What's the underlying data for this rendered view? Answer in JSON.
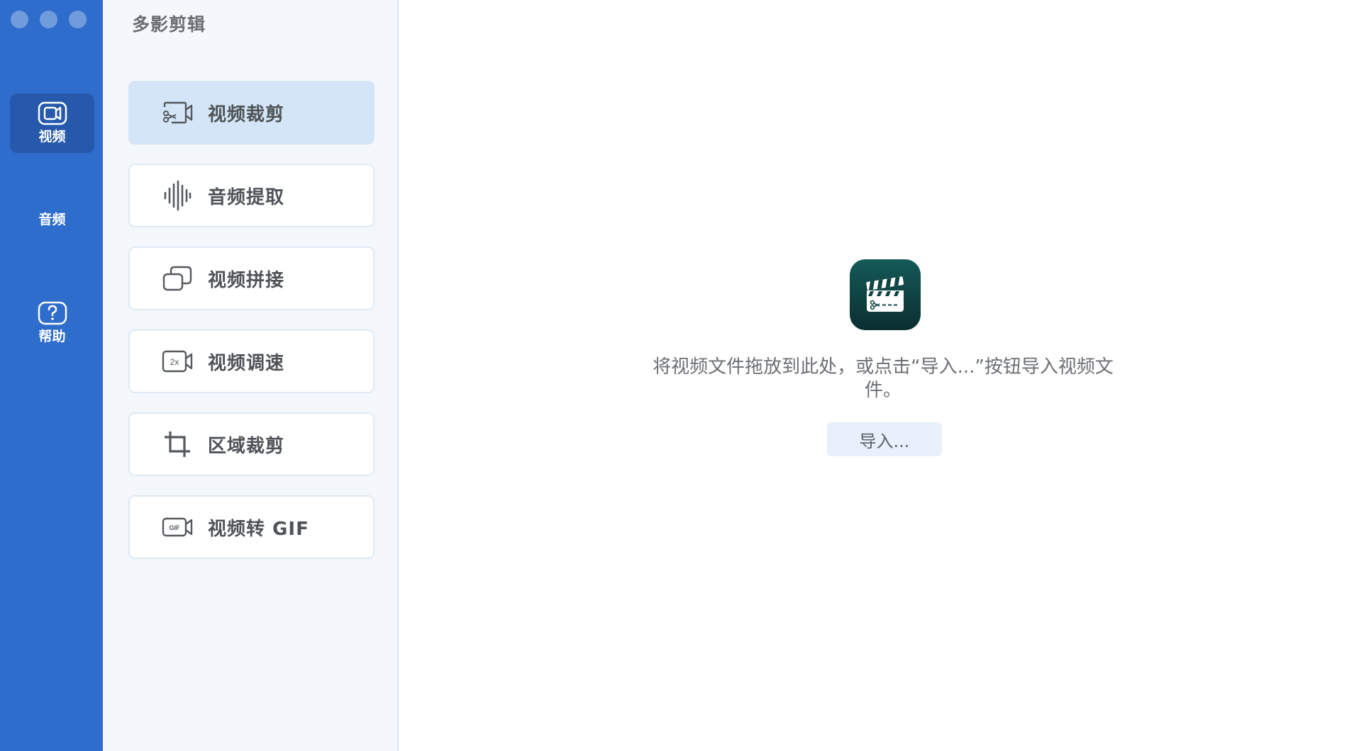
{
  "window": {
    "traffic_lights": [
      "close",
      "minimize",
      "zoom"
    ]
  },
  "rail": {
    "items": [
      {
        "label": "视频",
        "icon": "video-camera-icon",
        "active": true
      },
      {
        "label": "音频",
        "icon": "",
        "active": false
      },
      {
        "label": "帮助",
        "icon": "question-icon",
        "active": false
      }
    ]
  },
  "panel": {
    "title": "多影剪辑",
    "items": [
      {
        "label": "视频裁剪",
        "icon": "video-trim-icon",
        "active": true
      },
      {
        "label": "音频提取",
        "icon": "audio-waveform-icon",
        "active": false
      },
      {
        "label": "视频拼接",
        "icon": "video-merge-icon",
        "active": false
      },
      {
        "label": "视频调速",
        "icon": "video-speed-icon",
        "icon_text": "2x",
        "active": false
      },
      {
        "label": "区域裁剪",
        "icon": "crop-icon",
        "active": false
      },
      {
        "label": "视频转 GIF",
        "icon": "video-gif-icon",
        "icon_text": "GIF",
        "active": false
      }
    ]
  },
  "main": {
    "logo_icon": "clapperboard-icon",
    "hint": "将视频文件拖放到此处，或点击“导入...”按钮导入视频文件。",
    "import_label": "导入..."
  },
  "colors": {
    "rail_bg": "#2f6dcc",
    "rail_active": "#2659ac",
    "panel_bg": "#f4f8fd",
    "item_active": "#d3e5f6",
    "logo_top": "#145a58",
    "logo_bottom": "#0b2e2f",
    "import_bg": "#e8f0fb"
  }
}
